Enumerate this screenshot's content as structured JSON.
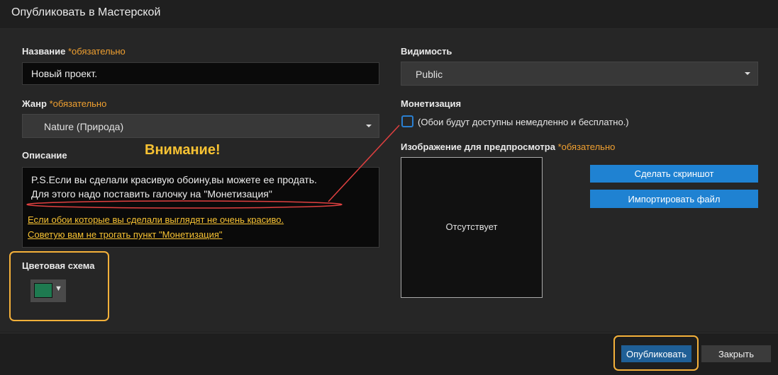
{
  "dialog": {
    "title": "Опубликовать в Мастерской"
  },
  "form": {
    "name": {
      "label": "Название",
      "required": "*обязательно",
      "value": "Новый проект."
    },
    "genre": {
      "label": "Жанр",
      "required": "*обязательно",
      "selected": "Nature (Природа)"
    },
    "description": {
      "label": "Описание",
      "line1": "P.S.Если вы сделали красивую обоину,вы можете ее продать.",
      "line2": "Для этого надо поставить галочку на \"Монетизация\""
    },
    "color_scheme": {
      "label": "Цветовая схема",
      "color": "#1e7a50"
    },
    "visibility": {
      "label": "Видимость",
      "selected": "Public"
    },
    "monetization": {
      "label": "Монетизация",
      "checkbox_text": "(Обои будут доступны немедленно и бесплатно.)",
      "checked": false
    },
    "preview": {
      "label": "Изображение для предпросмотра",
      "required": "*обязательно",
      "empty_text": "Отсутствует"
    },
    "screenshot_button": "Сделать скриншот",
    "import_button": "Импортировать файл"
  },
  "annotation": {
    "heading": "Внимание!",
    "line1": "Если обои которые вы сделали выглядят не очень красиво.",
    "line2": "Советую вам не трогать пункт \"Монетизация\""
  },
  "footer": {
    "publish_button": "Опубликовать",
    "close_button": "Закрыть"
  },
  "colors": {
    "accent": "#1f82d2",
    "highlight": "#f5b13a",
    "required": "#f0a030",
    "annotation_line": "#e04040"
  }
}
